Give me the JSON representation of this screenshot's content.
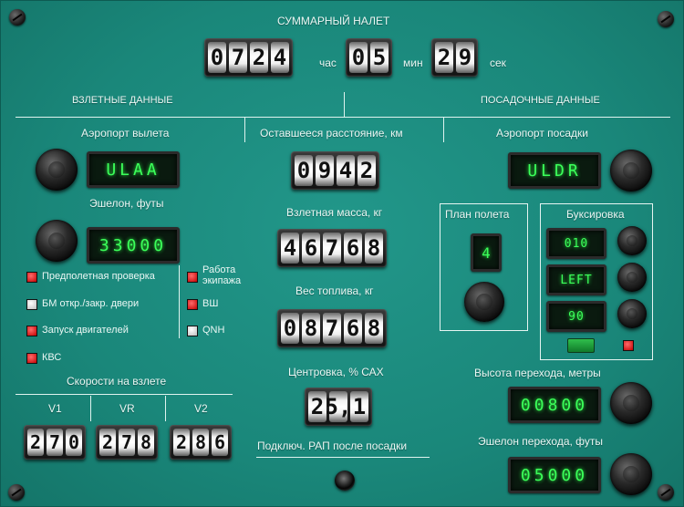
{
  "total_flight": {
    "title": "СУММАРНЫЙ   НАЛЕТ",
    "hours": [
      "0",
      "7",
      "2",
      "4"
    ],
    "hours_unit": "час",
    "minutes": [
      "0",
      "5"
    ],
    "minutes_unit": "мин",
    "seconds": [
      "2",
      "9"
    ],
    "seconds_unit": "сек"
  },
  "sections": {
    "takeoff": "ВЗЛЕТНЫЕ ДАННЫЕ",
    "landing": "ПОСАДОЧНЫЕ ДАННЫЕ"
  },
  "departure": {
    "label": "Аэропорт вылета",
    "code": "ULAA",
    "echelon_label": "Эшелон, футы",
    "echelon": "33000"
  },
  "checks": [
    {
      "label": "Предполетная проверка",
      "state": "red"
    },
    {
      "label": "БМ откр./закр. двери",
      "state": "white"
    },
    {
      "label": "Запуск двигателей",
      "state": "red"
    },
    {
      "label": "КВС",
      "state": "red"
    }
  ],
  "checks_right": [
    {
      "label": "Работа\nэкипажа",
      "state": "red"
    },
    {
      "label": "ВШ",
      "state": "red"
    },
    {
      "label": "QNH",
      "state": "white"
    }
  ],
  "takeoff_speeds": {
    "label": "Скорости на взлете",
    "v1_label": "V1",
    "vr_label": "VR",
    "v2_label": "V2",
    "v1": [
      "2",
      "7",
      "0"
    ],
    "vr": [
      "2",
      "7",
      "8"
    ],
    "v2": [
      "2",
      "8",
      "6"
    ]
  },
  "center": {
    "distance_label": "Оставшееся расстояние, км",
    "distance": [
      "0",
      "9",
      "4",
      "2"
    ],
    "mass_label": "Взлетная масса, кг",
    "mass": [
      "4",
      "6",
      "7",
      "6",
      "8"
    ],
    "fuel_label": "Вес топлива, кг",
    "fuel": [
      "0",
      "8",
      "7",
      "6",
      "8"
    ],
    "cg_label": "Центровка, % САХ",
    "cg": [
      "2",
      "5,",
      "1"
    ],
    "rap_label": "Подключ. РАП после посадки"
  },
  "arrival": {
    "label": "Аэропорт посадки",
    "code": "ULDR"
  },
  "flight_plan": {
    "label": "План полета",
    "value": "4"
  },
  "towing": {
    "label": "Буксировка",
    "values": [
      "010",
      "LEFT",
      "90"
    ]
  },
  "transition": {
    "altitude_label": "Высота перехода, метры",
    "altitude": "00800",
    "level_label": "Эшелон перехода, футы",
    "level": "05000"
  },
  "colors": {
    "panel": "#1c8a7c",
    "lcd_text": "#3cff5a",
    "led_red": "#d40000"
  }
}
